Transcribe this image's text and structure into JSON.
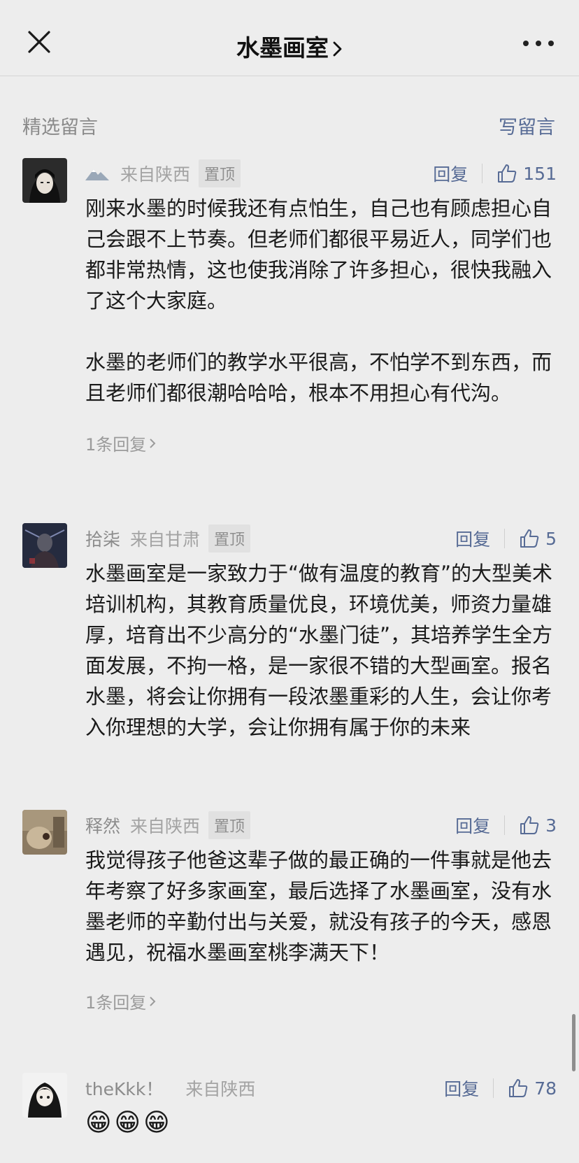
{
  "header": {
    "title": "水墨画室",
    "close_icon": "close-icon",
    "more_icon": "more-dots-icon"
  },
  "section": {
    "label": "精选留言",
    "write_label": "写留言"
  },
  "comments": [
    {
      "nickname": "",
      "location": "来自陕西",
      "pinned": "置顶",
      "reply_label": "回复",
      "likes": "151",
      "text": "刚来水墨的时候我还有点怕生，自己也有顾虑担心自己会跟不上节奏。但老师们都很平易近人，同学们也都非常热情，这也使我消除了许多担心，很快我融入了这个大家庭。\n\n水墨的老师们的教学水平很高，不怕学不到东西，而且老师们都很潮哈哈哈，根本不用担心有代沟。",
      "more_replies": "1条回复"
    },
    {
      "nickname": "拾柒",
      "location": "来自甘肃",
      "pinned": "置顶",
      "reply_label": "回复",
      "likes": "5",
      "text": "水墨画室是一家致力于“做有温度的教育”的大型美术培训机构，其教育质量优良，环境优美，师资力量雄厚，培育出不少高分的“水墨门徒”，其培养学生全方面发展，不拘一格，是一家很不错的大型画室。报名水墨，将会让你拥有一段浓墨重彩的人生，会让你考入你理想的大学，会让你拥有属于你的未来"
    },
    {
      "nickname": "释然",
      "location": "来自陕西",
      "pinned": "置顶",
      "reply_label": "回复",
      "likes": "3",
      "text": "我觉得孩子他爸这辈子做的最正确的一件事就是他去年考察了好多家画室，最后选择了水墨画室，没有水墨老师的辛勤付出与关爱，就没有孩子的今天，感恩遇见，祝福水墨画室桃李满天下！",
      "more_replies": "1条回复"
    },
    {
      "nickname": "theKkk！",
      "location": "来自陕西",
      "reply_label": "回复",
      "likes": "78",
      "emojis": [
        "😁",
        "😁",
        "😁"
      ]
    }
  ],
  "colors": {
    "background": "#ededed",
    "link": "#576b95",
    "muted": "#9a9a9a",
    "text": "#1a1a1a"
  }
}
